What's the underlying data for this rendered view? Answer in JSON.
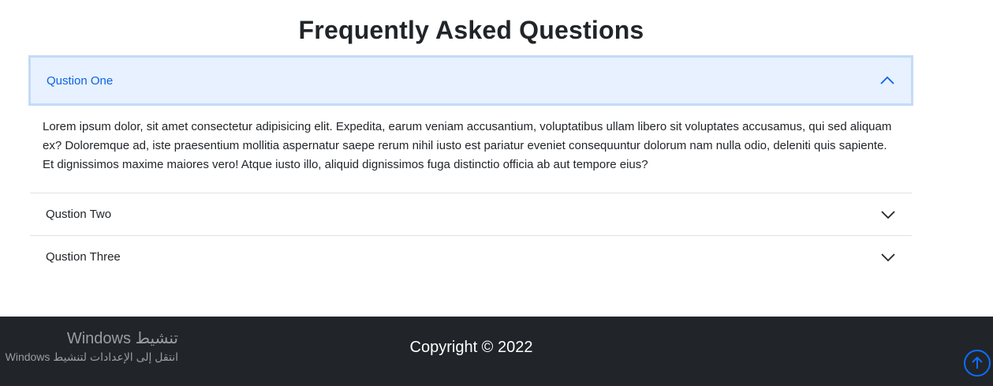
{
  "faq": {
    "title": "Frequently Asked Questions",
    "items": [
      {
        "question": "Qustion One",
        "expanded": true,
        "answer": "Lorem ipsum dolor, sit amet consectetur adipisicing elit. Expedita, earum veniam accusantium, voluptatibus ullam libero sit voluptates accusamus, qui sed aliquam ex? Doloremque ad, iste praesentium mollitia aspernatur saepe rerum nihil iusto est pariatur eveniet consequuntur dolorum nam nulla odio, deleniti quis sapiente. Et dignissimos maxime maiores vero! Atque iusto illo, aliquid dignissimos fuga distinctio officia ab aut tempore eius?"
      },
      {
        "question": "Qustion Two",
        "expanded": false
      },
      {
        "question": "Qustion Three",
        "expanded": false
      }
    ]
  },
  "footer": {
    "copyright": "Copyright © 2022",
    "watermark_line1": "تنشيط Windows",
    "watermark_line2": "انتقل إلى الإعدادات لتنشيط Windows",
    "scroll_top_icon": "arrow-up-circle-icon"
  },
  "colors": {
    "accent": "#0c63e4",
    "open_bg": "#e7f1ff",
    "footer_bg": "#212529",
    "scroll_icon": "#0d6efd"
  }
}
